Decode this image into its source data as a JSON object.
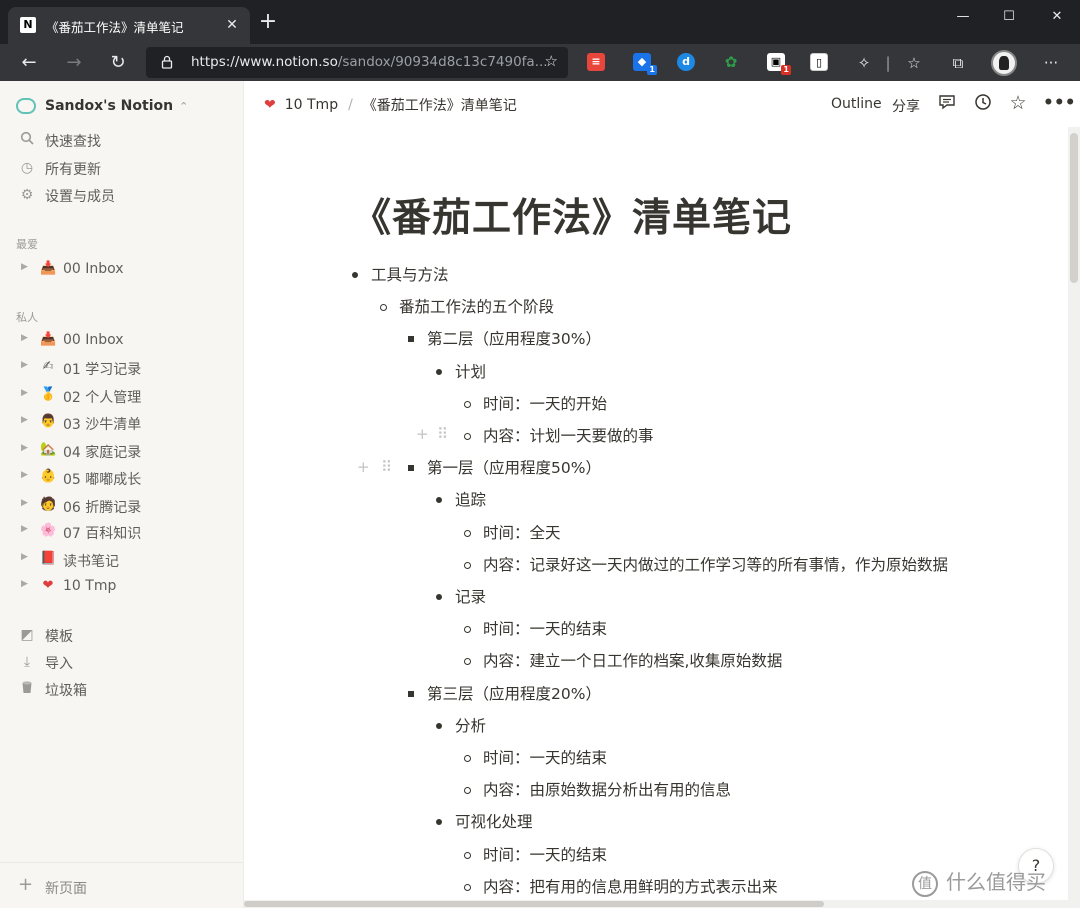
{
  "browser": {
    "tab_title": "《番茄工作法》清单笔记",
    "tab_favicon": "N",
    "url_main": "https://www.notion.so",
    "url_rest": "/sandox/90934d8c13c7490fa...",
    "minimize": "—",
    "maximize": "☐",
    "close": "✕"
  },
  "sidebar": {
    "workspace_name": "Sandox's Notion",
    "quick": [
      {
        "label": "快速查找",
        "icon": "search-icon"
      },
      {
        "label": "所有更新",
        "icon": "clock-icon"
      },
      {
        "label": "设置与成员",
        "icon": "gear-icon"
      }
    ],
    "favorites_label": "最爱",
    "favorites": [
      {
        "emoji": "📥",
        "label": "00 Inbox"
      }
    ],
    "private_label": "私人",
    "private": [
      {
        "emoji": "📥",
        "label": "00 Inbox"
      },
      {
        "emoji": "✍",
        "label": "01 学习记录"
      },
      {
        "emoji": "🥇",
        "label": "02 个人管理"
      },
      {
        "emoji": "👨",
        "label": "03 沙牛清单"
      },
      {
        "emoji": "🏡",
        "label": "04 家庭记录"
      },
      {
        "emoji": "👶",
        "label": "05 嘟嘟成长"
      },
      {
        "emoji": "🧑",
        "label": "06 折腾记录"
      },
      {
        "emoji": "🌸",
        "label": "07 百科知识"
      },
      {
        "emoji": "📕",
        "label": "读书笔记"
      },
      {
        "emoji": "❤",
        "label": "10 Tmp"
      }
    ],
    "tools": [
      {
        "label": "模板",
        "icon": "template-icon"
      },
      {
        "label": "导入",
        "icon": "import-icon"
      },
      {
        "label": "垃圾箱",
        "icon": "trash-icon"
      }
    ],
    "new_page": "新页面"
  },
  "topbar": {
    "breadcrumb_parent": "10 Tmp",
    "breadcrumb_sep": "/",
    "breadcrumb_current": "《番茄工作法》清单笔记",
    "outline": "Outline",
    "share": "分享"
  },
  "page": {
    "title": "《番茄工作法》清单笔记",
    "items": [
      {
        "level": 0,
        "text": "工具与方法"
      },
      {
        "level": 1,
        "text": "番茄工作法的五个阶段"
      },
      {
        "level": 2,
        "text": "第二层（应用程度30%）"
      },
      {
        "level": 3,
        "text": "计划"
      },
      {
        "level": 4,
        "text": "时间：一天的开始"
      },
      {
        "level": 4,
        "text": "内容：计划一天要做的事"
      },
      {
        "level": 2,
        "text": "第一层（应用程度50%）"
      },
      {
        "level": 3,
        "text": "追踪"
      },
      {
        "level": 4,
        "text": "时间：全天"
      },
      {
        "level": 4,
        "text": "内容：记录好这一天内做过的工作学习等的所有事情，作为原始数据"
      },
      {
        "level": 3,
        "text": "记录"
      },
      {
        "level": 4,
        "text": "时间：一天的结束"
      },
      {
        "level": 4,
        "text": "内容：建立一个日工作的档案,收集原始数据"
      },
      {
        "level": 2,
        "text": "第三层（应用程度20%）"
      },
      {
        "level": 3,
        "text": "分析"
      },
      {
        "level": 4,
        "text": "时间：一天的结束"
      },
      {
        "level": 4,
        "text": "内容：由原始数据分析出有用的信息"
      },
      {
        "level": 3,
        "text": "可视化处理"
      },
      {
        "level": 4,
        "text": "时间：一天的结束"
      },
      {
        "level": 4,
        "text": "内容：把有用的信息用鲜明的方式表示出来"
      }
    ]
  },
  "help_label": "?",
  "watermark": "什么值得买",
  "colors": {
    "accent_heart": "#e03e3e",
    "sidebar_bg": "#f7f6f3",
    "text": "#37352f"
  }
}
